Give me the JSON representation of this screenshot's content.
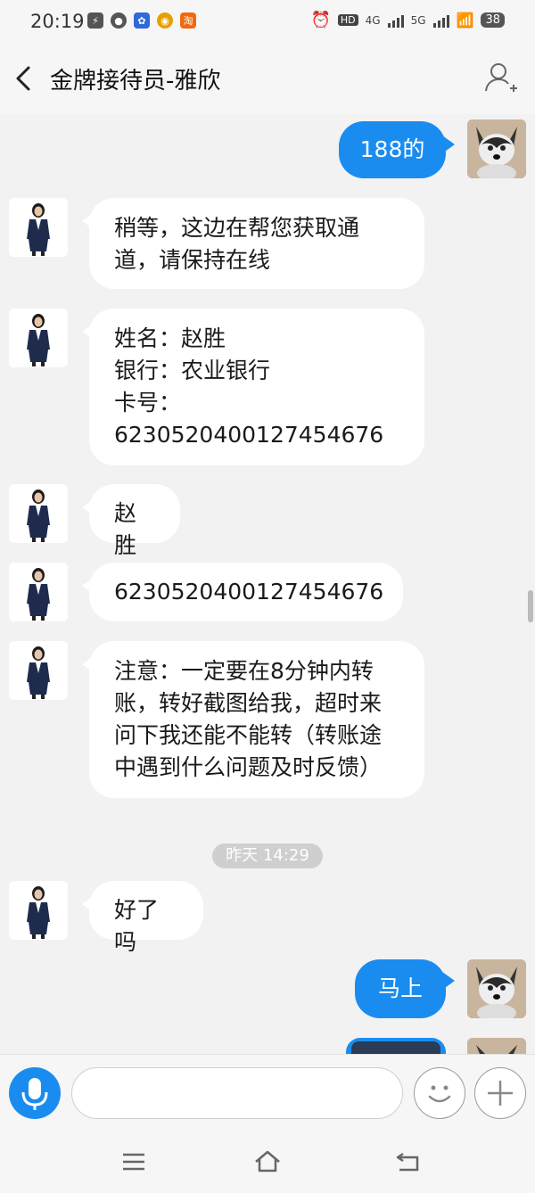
{
  "status_bar": {
    "time": "20:19",
    "network_1": "4G",
    "network_2": "5G",
    "hd": "HD",
    "battery": "38",
    "apps": [
      {
        "name": "flash-app-icon",
        "color": "#555555",
        "glyph": "⚡"
      },
      {
        "name": "message-app-icon",
        "color": "#555555",
        "glyph": "●"
      },
      {
        "name": "baidu-app-icon",
        "color": "#2e6bd9",
        "glyph": "✿"
      },
      {
        "name": "browser-app-icon",
        "color": "#e8a000",
        "glyph": "◉"
      },
      {
        "name": "taobao-app-icon",
        "color": "#f0690f",
        "glyph": "淘"
      }
    ]
  },
  "header": {
    "title": "金牌接待员-雅欣"
  },
  "messages": [
    {
      "side": "right",
      "text": "188的"
    },
    {
      "side": "left",
      "lines": [
        "稍等，这边在帮您获取通",
        "道，请保持在线"
      ]
    },
    {
      "side": "left",
      "lines": [
        "姓名：赵胜",
        "银行：农业银行",
        "卡号：",
        "6230520400127454676"
      ]
    },
    {
      "side": "left",
      "text": "赵胜"
    },
    {
      "side": "left",
      "text": "6230520400127454676"
    },
    {
      "side": "left",
      "lines": [
        "注意：一定要在8分钟内转",
        "账，转好截图给我，超时来",
        "问下我还能不能转（转账途",
        "中遇到什么问题及时反馈）"
      ]
    },
    {
      "side": "left",
      "text": "好了吗"
    },
    {
      "side": "right",
      "text": "马上"
    }
  ],
  "timestamp": "昨天 14:29",
  "input": {
    "placeholder": ""
  },
  "colors": {
    "accent": "#1a8cf0",
    "background": "#f2f2f2"
  }
}
